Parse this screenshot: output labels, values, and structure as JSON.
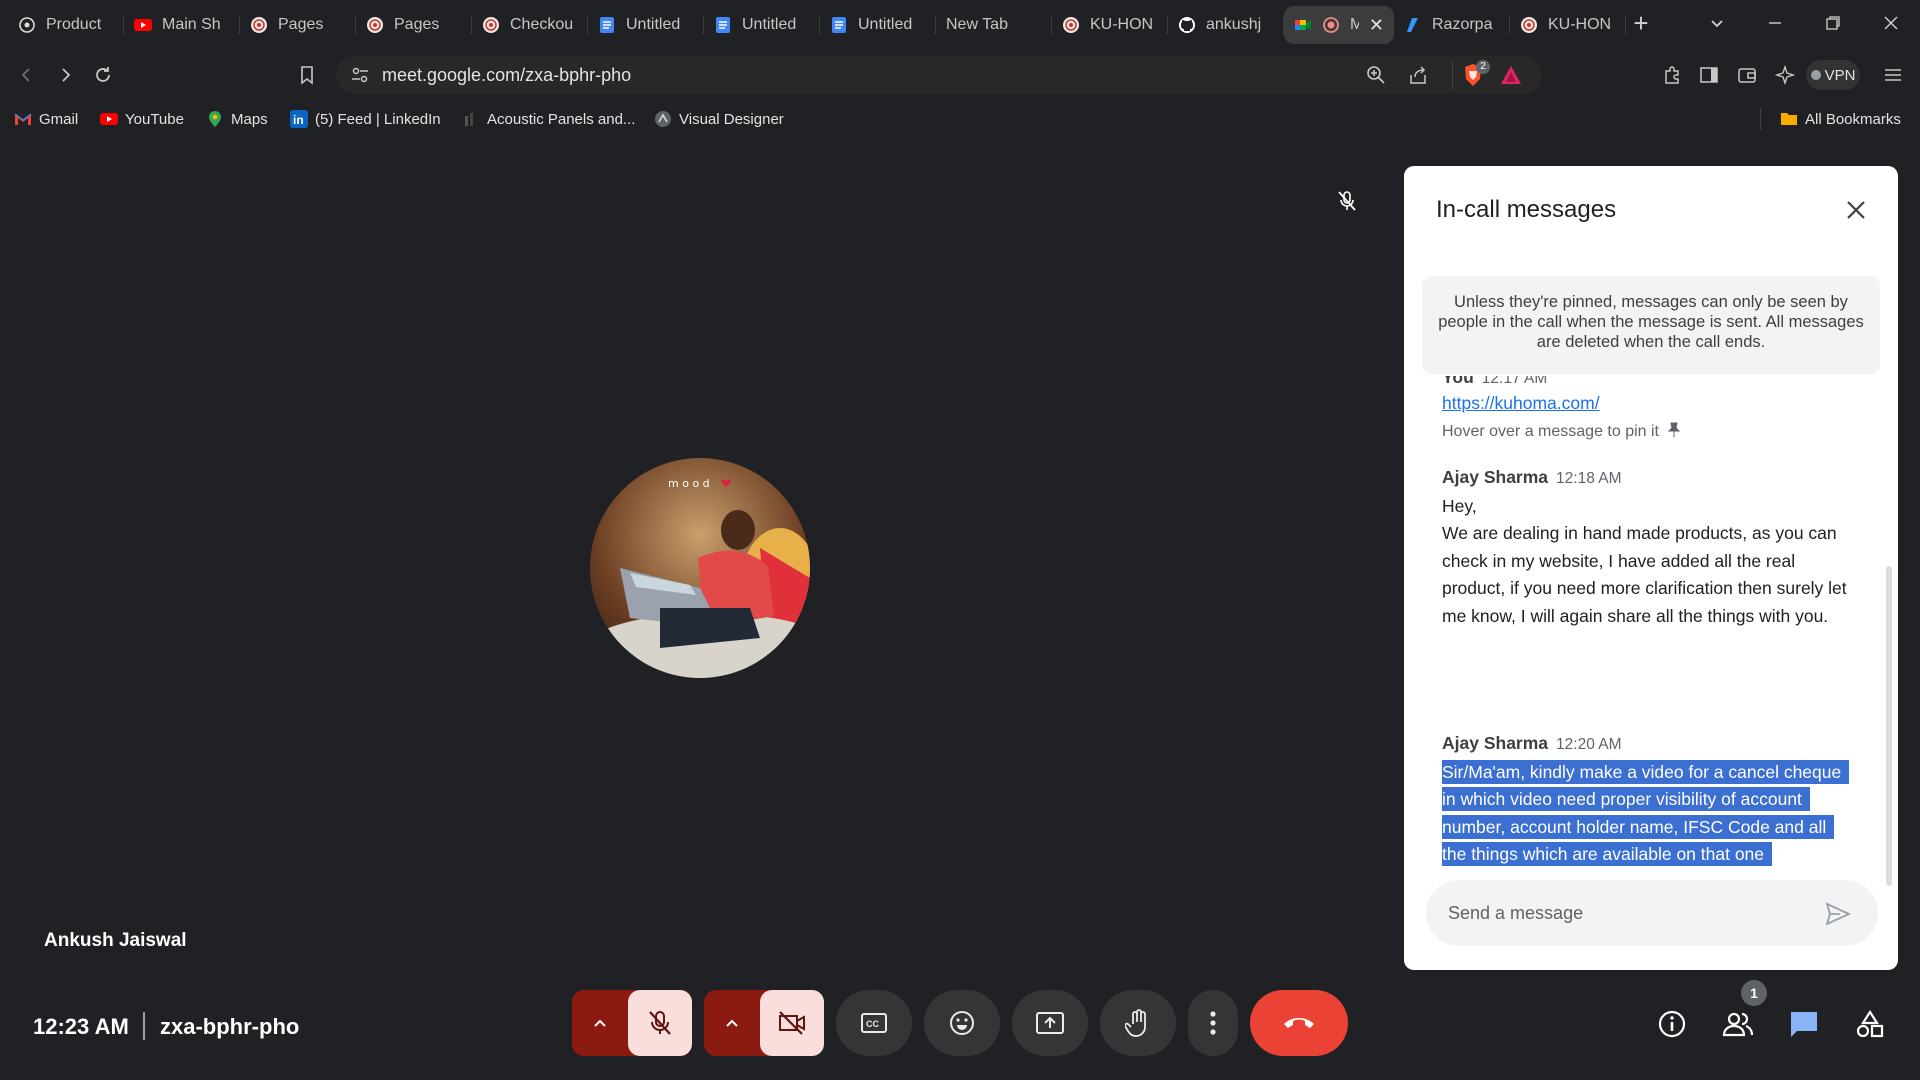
{
  "browser": {
    "tabs": [
      {
        "label": "Product",
        "icon": "openai-icon"
      },
      {
        "label": "Main Sh",
        "icon": "youtube-icon"
      },
      {
        "label": "Pages",
        "icon": "site-icon"
      },
      {
        "label": "Pages",
        "icon": "site-icon"
      },
      {
        "label": "Checkou",
        "icon": "site-icon"
      },
      {
        "label": "Untitled",
        "icon": "google-docs-icon"
      },
      {
        "label": "Untitled",
        "icon": "google-docs-icon"
      },
      {
        "label": "Untitled",
        "icon": "google-docs-icon"
      },
      {
        "label": "New Tab",
        "icon": ""
      },
      {
        "label": "KU-HON",
        "icon": "site-icon"
      },
      {
        "label": "ankushj",
        "icon": "github-icon"
      },
      {
        "label": "M",
        "icon": "google-meet-icon",
        "active": true,
        "close": "✕"
      },
      {
        "label": "Razorpa",
        "icon": "razorpay-icon"
      },
      {
        "label": "KU-HON",
        "icon": "site-icon"
      }
    ],
    "new_tab_label": "+",
    "url": "meet.google.com/zxa-bphr-pho",
    "vpn_label": "VPN",
    "brave_badge": "2",
    "bookmarks": [
      {
        "label": "Gmail",
        "icon": "gmail-icon"
      },
      {
        "label": "YouTube",
        "icon": "youtube-icon"
      },
      {
        "label": "Maps",
        "icon": "maps-icon"
      },
      {
        "label": "(5) Feed | LinkedIn",
        "icon": "linkedin-icon"
      },
      {
        "label": "Acoustic Panels and...",
        "icon": "site-icon"
      },
      {
        "label": "Visual Designer",
        "icon": "site-icon"
      }
    ],
    "all_bookmarks_label": "All Bookmarks"
  },
  "meet": {
    "participant_name": "Ankush Jaiswal",
    "avatar_caption": "m o o d",
    "meeting_time": "12:23 AM",
    "meeting_code": "zxa-bphr-pho",
    "people_count": "1",
    "colors": {
      "leave": "#ea4335",
      "mic_off_bg": "#f9dedc",
      "pill_bg": "#8b1a10",
      "selection": "#3b6fd1"
    }
  },
  "chat": {
    "title": "In-call messages",
    "notice": "Unless they're pinned, messages can only be seen by people in the call when the message is sent. All messages are deleted when the call ends.",
    "truncated_sender": "You",
    "truncated_time": "12:17 AM",
    "link": "https://kuhoma.com/",
    "pin_hint": "Hover over a message to pin it",
    "messages": [
      {
        "sender": "Ajay Sharma",
        "time": "12:18 AM",
        "text_1": "Hey,",
        "text_2": "We are dealing in hand made products, as you can check in my website, I have added all the real product, if you need more clarification then surely let me know, I will again share all the things with you."
      },
      {
        "sender": "Ajay Sharma",
        "time": "12:20 AM",
        "text": "Sir/Ma'am, kindly make a video for a cancel cheque in which video need proper visibility of account number, account holder name, IFSC Code and all the things which are available on that one"
      }
    ],
    "input_placeholder": "Send a message"
  }
}
